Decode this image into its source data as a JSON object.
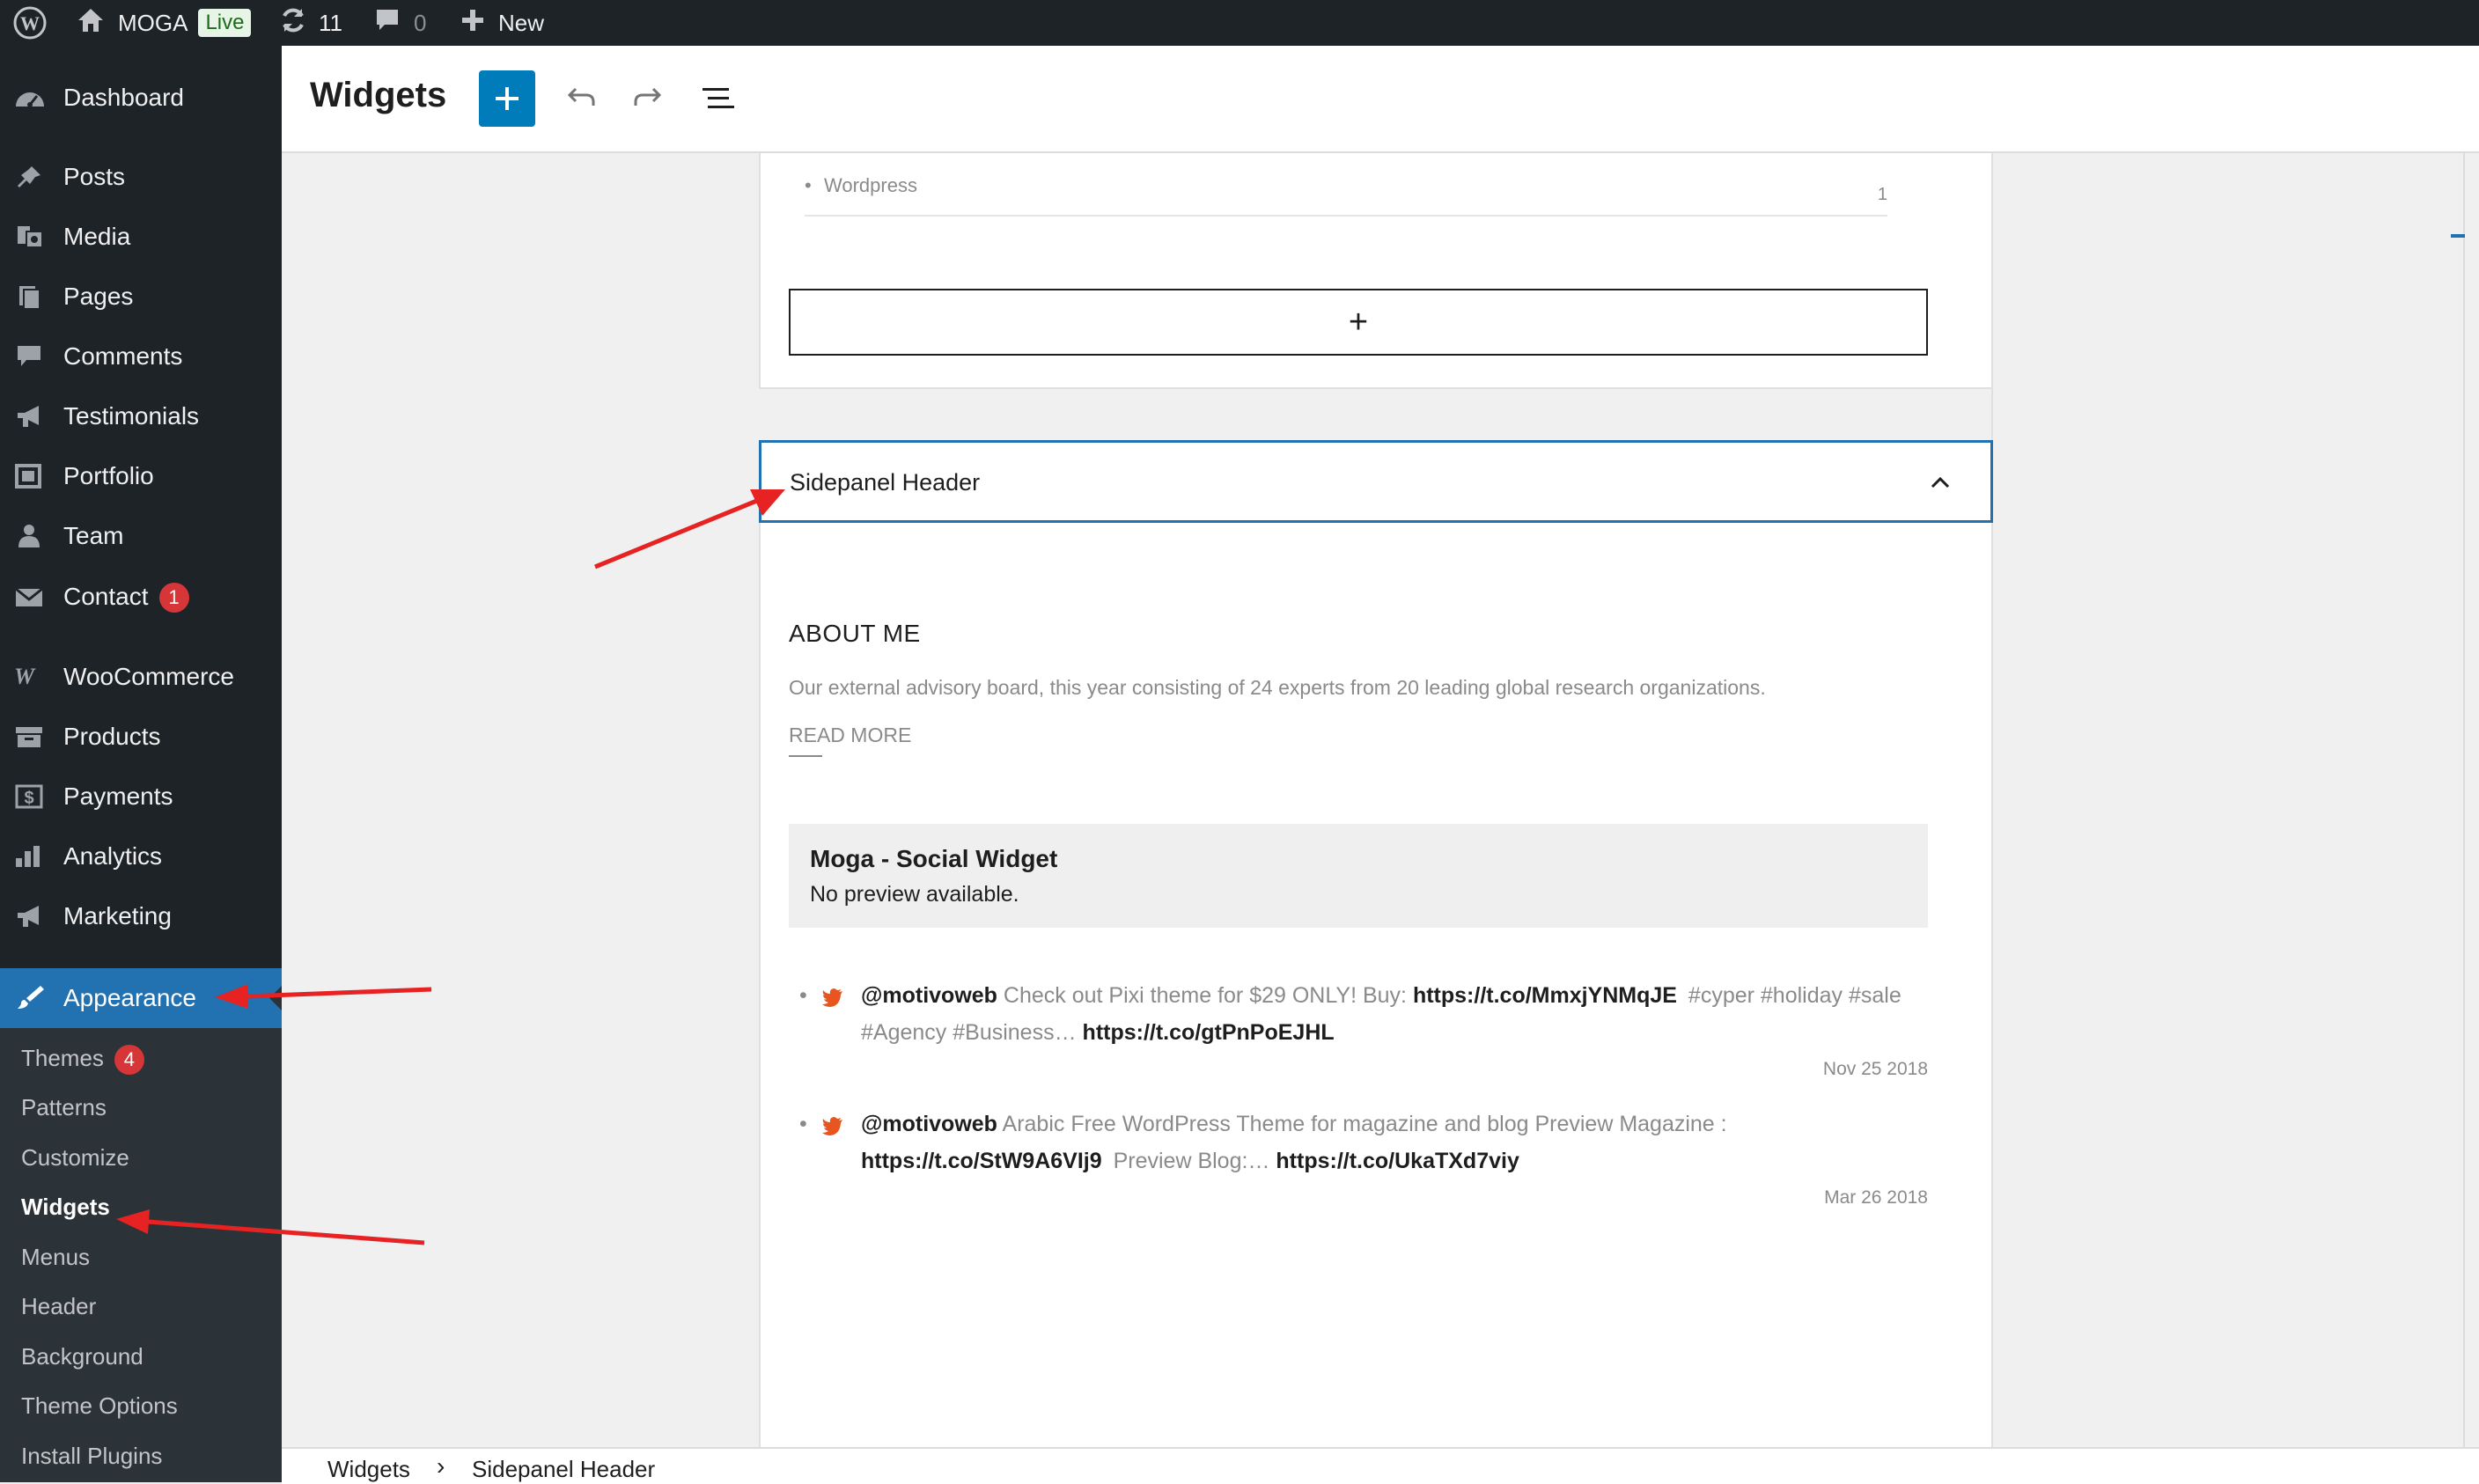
{
  "adminbar": {
    "site_name": "MOGA",
    "live_badge": "Live",
    "updates_count": "11",
    "comments_count": "0",
    "new_label": "New"
  },
  "sidebar": {
    "items": [
      {
        "label": "Dashboard",
        "icon": "dashboard-icon"
      },
      {
        "label": "Posts",
        "icon": "pin-icon"
      },
      {
        "label": "Media",
        "icon": "media-icon"
      },
      {
        "label": "Pages",
        "icon": "pages-icon"
      },
      {
        "label": "Comments",
        "icon": "comment-icon"
      },
      {
        "label": "Testimonials",
        "icon": "megaphone-icon"
      },
      {
        "label": "Portfolio",
        "icon": "portfolio-icon"
      },
      {
        "label": "Team",
        "icon": "person-icon"
      },
      {
        "label": "Contact",
        "icon": "mail-icon",
        "badge": "1"
      },
      {
        "label": "WooCommerce",
        "icon": "woo-icon"
      },
      {
        "label": "Products",
        "icon": "archive-icon"
      },
      {
        "label": "Payments",
        "icon": "dollar-icon"
      },
      {
        "label": "Analytics",
        "icon": "bar-chart-icon"
      },
      {
        "label": "Marketing",
        "icon": "megaphone-icon"
      },
      {
        "label": "Appearance",
        "icon": "brush-icon"
      }
    ],
    "submenu": [
      {
        "label": "Themes",
        "badge": "4"
      },
      {
        "label": "Patterns"
      },
      {
        "label": "Customize"
      },
      {
        "label": "Widgets"
      },
      {
        "label": "Menus"
      },
      {
        "label": "Header"
      },
      {
        "label": "Background"
      },
      {
        "label": "Theme Options"
      },
      {
        "label": "Install Plugins"
      }
    ]
  },
  "header": {
    "title": "Widgets"
  },
  "canvas": {
    "category_item": "Wordpress",
    "category_count": "1",
    "add_block_symbol": "+",
    "widget_area_title": "Sidepanel Header",
    "about_heading": "ABOUT ME",
    "about_text": "Our external advisory board, this year consisting of 24 experts from 20 leading global research organizations.",
    "read_more": "READ MORE",
    "social_widget_title": "Moga - Social Widget",
    "social_widget_note": "No preview available.",
    "tweets": [
      {
        "handle": "@motivoweb",
        "text1": "Check out Pixi theme for $29 ONLY! Buy:",
        "link1": "https://t.co/MmxjYNMqJE",
        "text2": "#cyper #holiday #sale",
        "text3": "#Agency #Business…",
        "link2": "https://t.co/gtPnPoEJHL",
        "date": "Nov 25 2018"
      },
      {
        "handle": "@motivoweb",
        "text1": "Arabic Free WordPress Theme for magazine and blog Preview Magazine :",
        "link1": "https://t.co/StW9A6VIj9",
        "text2": "Preview Blog:…",
        "link2": "https://t.co/UkaTXd7viy",
        "date": "Mar 26 2018"
      }
    ]
  },
  "footer": {
    "breadcrumb_root": "Widgets",
    "breadcrumb_sep": "›",
    "breadcrumb_current": "Sidepanel Header"
  },
  "colors": {
    "admin_dark": "#1d2327",
    "accent_blue": "#2271b1",
    "button_blue": "#007cba",
    "badge_red": "#d63638",
    "twitter_orange": "#e8551f",
    "annotation_red": "#e62222"
  }
}
